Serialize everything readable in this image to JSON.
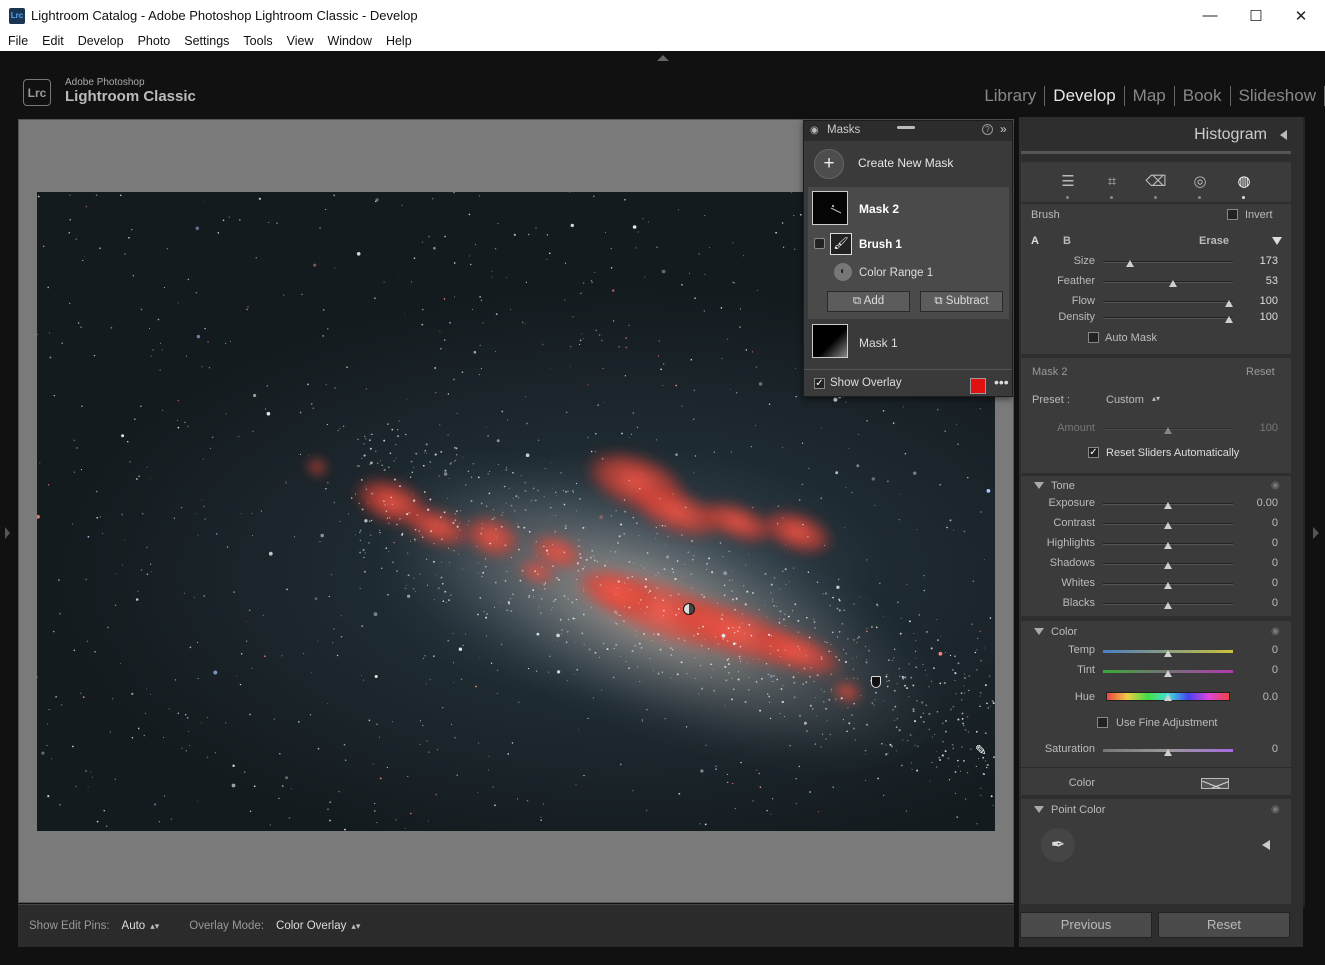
{
  "window": {
    "title": "Lightroom Catalog - Adobe Photoshop Lightroom Classic - Develop",
    "app_icon": "Lrc",
    "controls": {
      "minimize": "—",
      "maximize": "☐",
      "close": "✕"
    }
  },
  "menu": [
    "File",
    "Edit",
    "Develop",
    "Photo",
    "Settings",
    "Tools",
    "View",
    "Window",
    "Help"
  ],
  "header": {
    "logo": "Lrc",
    "brand_small": "Adobe Photoshop",
    "brand_large": "Lightroom Classic",
    "modules": [
      "Library",
      "Develop",
      "Map",
      "Book",
      "Slideshow",
      "|"
    ],
    "active_module": "Develop"
  },
  "toolbar": {
    "edit_pins_label": "Show Edit Pins:",
    "edit_pins_value": "Auto",
    "overlay_mode_label": "Overlay Mode:",
    "overlay_mode_value": "Color Overlay",
    "updown": "▴▾"
  },
  "masks_panel": {
    "title": "Masks",
    "help": "?",
    "collapse": "»",
    "create_label": "Create New Mask",
    "create_icon": "+",
    "mask2": {
      "name": "Mask 2",
      "components": [
        {
          "name": "Brush 1",
          "icon": "brush-icon"
        },
        {
          "name": "Color Range 1",
          "icon": "color-range-icon"
        }
      ],
      "add_label": "Add",
      "subtract_label": "Subtract"
    },
    "mask1": {
      "name": "Mask 1"
    },
    "show_overlay_label": "Show Overlay",
    "show_overlay_checked": true,
    "overlay_color": "#e01010",
    "more": "•••"
  },
  "right_panel": {
    "histogram_label": "Histogram",
    "tools": [
      "edit-sliders-icon",
      "crop-icon",
      "heal-icon",
      "redeye-icon",
      "masking-icon"
    ],
    "brush": {
      "label": "Brush",
      "invert_label": "Invert",
      "invert_checked": false,
      "brush_a": "A",
      "brush_b": "B",
      "erase_label": "Erase",
      "size_label": "Size",
      "size_value": "173",
      "feather_label": "Feather",
      "feather_value": "53",
      "flow_label": "Flow",
      "flow_value": "100",
      "density_label": "Density",
      "density_value": "100",
      "automask_label": "Auto Mask",
      "automask_checked": false
    },
    "mask_settings": {
      "mask_name": "Mask 2",
      "reset_label": "Reset",
      "preset_label": "Preset :",
      "preset_value": "Custom",
      "amount_label": "Amount",
      "amount_value": "100",
      "reset_sliders_label": "Reset Sliders Automatically",
      "reset_sliders_checked": true
    },
    "tone": {
      "title": "Tone",
      "rows": [
        {
          "label": "Exposure",
          "value": "0.00"
        },
        {
          "label": "Contrast",
          "value": "0"
        },
        {
          "label": "Highlights",
          "value": "0"
        },
        {
          "label": "Shadows",
          "value": "0"
        },
        {
          "label": "Whites",
          "value": "0"
        },
        {
          "label": "Blacks",
          "value": "0"
        }
      ]
    },
    "color": {
      "title": "Color",
      "temp_label": "Temp",
      "temp_value": "0",
      "tint_label": "Tint",
      "tint_value": "0",
      "hue_label": "Hue",
      "hue_value": "0.0",
      "fine_label": "Use Fine Adjustment",
      "fine_checked": false,
      "sat_label": "Saturation",
      "sat_value": "0",
      "color_label": "Color"
    },
    "point_color": {
      "title": "Point Color"
    },
    "previous_label": "Previous",
    "reset_label": "Reset"
  }
}
